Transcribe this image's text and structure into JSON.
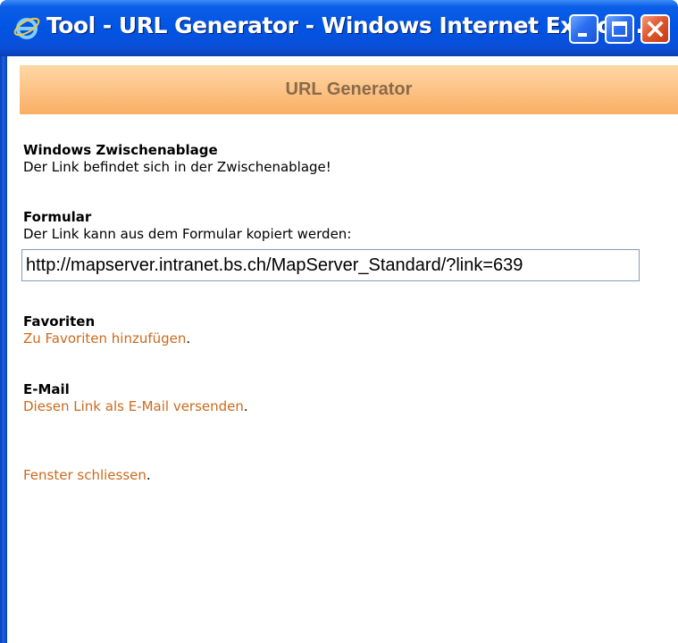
{
  "window": {
    "title": "Tool - URL Generator - Windows Internet Explor...",
    "icon": "ie-icon",
    "controls": [
      "minimize-icon",
      "maximize-icon",
      "close-icon"
    ]
  },
  "header": {
    "title": "URL Generator"
  },
  "clipboard": {
    "heading": "Windows Zwischenablage",
    "text": "Der Link befindet sich in der Zwischenablage!"
  },
  "form": {
    "heading": "Formular",
    "text": "Der Link kann aus dem Formular kopiert werden:",
    "url_value": "http://mapserver.intranet.bs.ch/MapServer_Standard/?link=639"
  },
  "favorites": {
    "heading": "Favoriten",
    "link": "Zu Favoriten hinzufügen",
    "suffix": "."
  },
  "email": {
    "heading": "E-Mail",
    "link": "Diesen Link als E-Mail versenden",
    "suffix": "."
  },
  "close_window": {
    "link": "Fenster schliessen",
    "suffix": "."
  },
  "colors": {
    "titlebar": "#0054e3",
    "header_bar": "#fcc58a",
    "header_text": "#8a6a4a",
    "link": "#cc6a1c"
  }
}
